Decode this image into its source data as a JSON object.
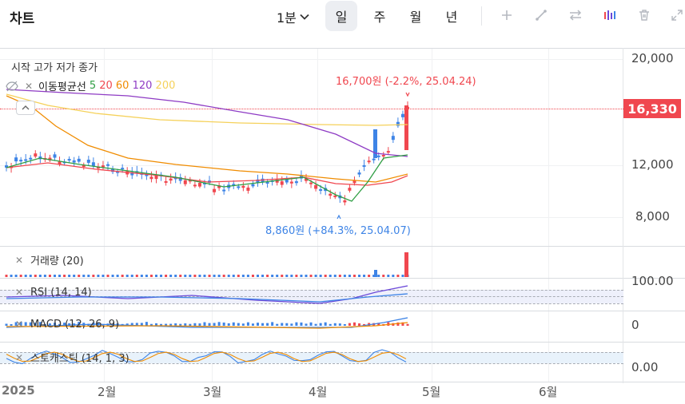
{
  "toolbar": {
    "title": "차트",
    "interval": "1분",
    "periods": [
      "일",
      "주",
      "월",
      "년"
    ],
    "active_period": "일",
    "tools": [
      "plus-icon",
      "draw-line-icon",
      "compare-arrows-icon",
      "indicator-icon",
      "trash-icon",
      "expand-icon"
    ]
  },
  "main": {
    "ohlc_legend": "시작 고가 저가 종가",
    "ma_legend": {
      "name": "이동평균선",
      "periods": [
        "5",
        "20",
        "60",
        "120",
        "200"
      ],
      "colors": [
        "#2f9e44",
        "#f0474f",
        "#f08c00",
        "#8e3bc4",
        "#f5d15a"
      ]
    },
    "y_ticks": [
      "20,000",
      "12,000",
      "8,000"
    ],
    "current_price": "16,330",
    "high_annotation": "16,700원 (-2.2%, 25.04.24)",
    "low_annotation": "8,860원 (+84.3%, 25.04.07)"
  },
  "volume": {
    "label": "거래량 (20)"
  },
  "rsi": {
    "label": "RSI (14, 14)",
    "axis": "100.00"
  },
  "macd": {
    "label": "MACD (12, 26, 9)",
    "axis": "0"
  },
  "stochastic": {
    "label": "스토캐스틱 (14, 1, 3)",
    "axis": "0.00"
  },
  "x_axis": {
    "labels": [
      "2025",
      "2월",
      "3월",
      "4월",
      "5월",
      "6월"
    ]
  },
  "colors": {
    "up": "#f0474f",
    "down": "#3e84e6",
    "accent": "#6c4ad9"
  }
}
